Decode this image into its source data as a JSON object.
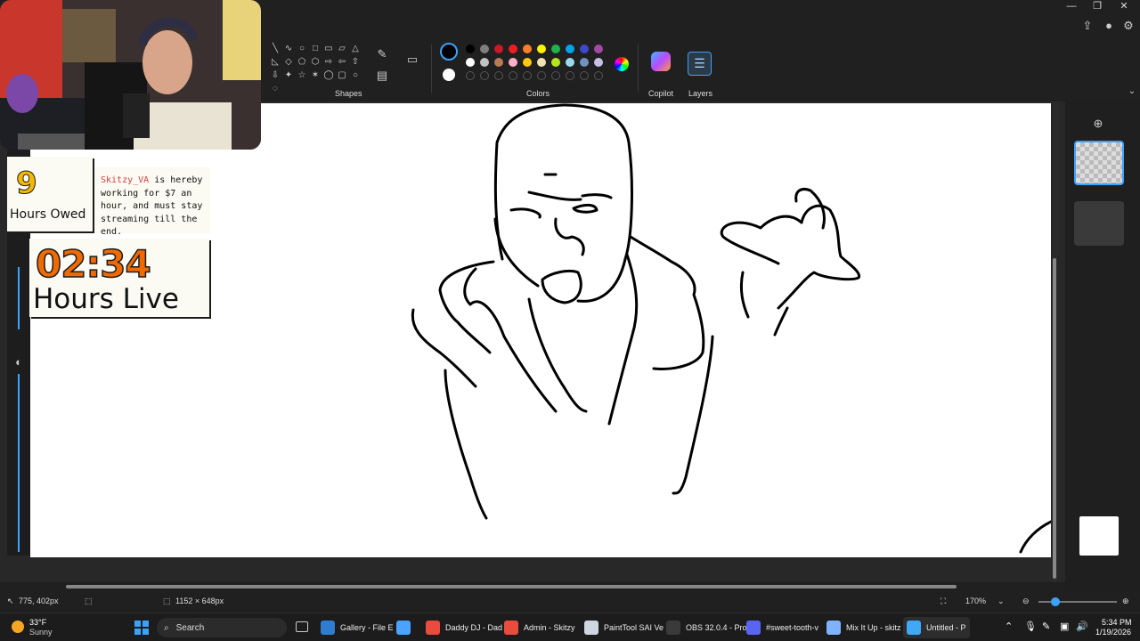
{
  "titlebar": {
    "controls": [
      "—",
      "❐",
      "✕"
    ],
    "icons": [
      "share-icon",
      "account-icon",
      "settings-icon"
    ]
  },
  "ribbon": {
    "shapes_label": "Shapes",
    "colors_label": "Colors",
    "copilot_label": "Copilot",
    "layers_label": "Layers",
    "shape_glyphs": [
      "╲",
      "∿",
      "○",
      "□",
      "▭",
      "▱",
      "△",
      "◺",
      "◇",
      "⬠",
      "⬡",
      "⇨",
      "⇦",
      "⇧",
      "⇩",
      "✦",
      "☆",
      "✶",
      "◯",
      "▢",
      "○",
      "◌"
    ],
    "palette_row1": [
      "#000000",
      "#7f7f7f",
      "#c51a28",
      "#ee1d24",
      "#ff7f27",
      "#fff200",
      "#22b14c",
      "#00a2e8",
      "#3f48cc",
      "#a349a4"
    ],
    "palette_row2": [
      "#ffffff",
      "#c3c3c3",
      "#b97a57",
      "#ffaec9",
      "#ffc90e",
      "#efe4b0",
      "#b5e61d",
      "#99d9ea",
      "#7092be",
      "#c8bfe7"
    ],
    "primary_color": "#000000",
    "secondary_color": "#ffffff"
  },
  "overlay": {
    "hours_owed_value": "9",
    "hours_owed_label": "Hours Owed",
    "note_user": "Skitzy_VA",
    "note_text": " is hereby working for $7 an hour, and must stay streaming till the end.",
    "timer": "02:34",
    "hours_live_label": "Hours Live"
  },
  "status": {
    "cursor_pos": "775, 402px",
    "canvas_size": "1152 × 648px",
    "zoom": "170%"
  },
  "taskbar": {
    "weather_temp": "33°F",
    "weather_desc": "Sunny",
    "search_placeholder": "Search",
    "apps": [
      {
        "label": "Gallery - File E",
        "color": "#2f7dd1"
      },
      {
        "label": "Daddy DJ - Dad",
        "color": "#e94b3c"
      },
      {
        "label": "Admin - Skitzy",
        "color": "#e94b3c"
      },
      {
        "label": "PaintTool SAI Ve",
        "color": "#cfd6e0"
      },
      {
        "label": "OBS 32.0.4 - Pro",
        "color": "#3a3a3a"
      },
      {
        "label": "#sweet-tooth-v",
        "color": "#5865f2"
      },
      {
        "label": "Mix It Up - skitz",
        "color": "#7fb2ff"
      },
      {
        "label": "Untitled - P",
        "color": "#3fa9f5"
      }
    ],
    "time": "5:34 PM",
    "date": "1/19/2026"
  }
}
